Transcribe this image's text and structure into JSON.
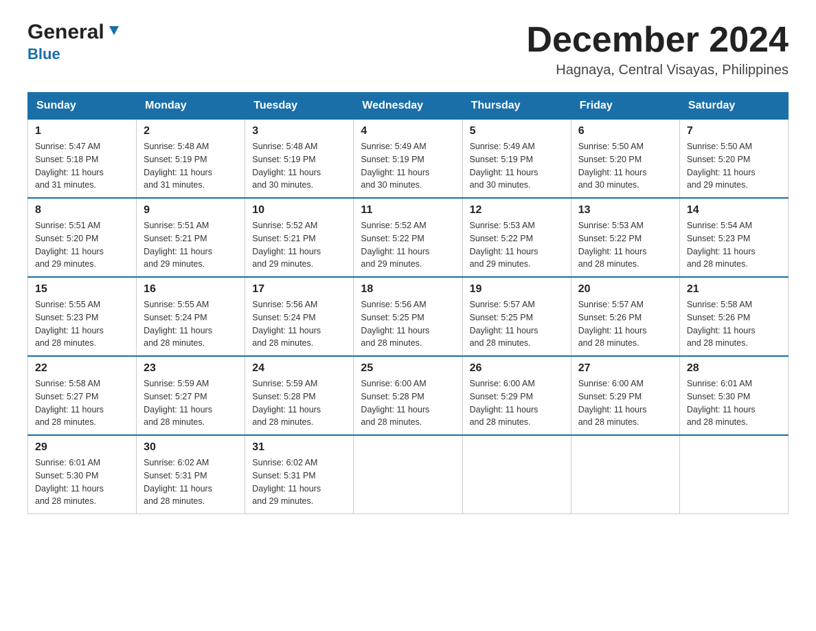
{
  "header": {
    "logo_general": "General",
    "logo_blue": "Blue",
    "month_title": "December 2024",
    "location": "Hagnaya, Central Visayas, Philippines"
  },
  "days_of_week": [
    "Sunday",
    "Monday",
    "Tuesday",
    "Wednesday",
    "Thursday",
    "Friday",
    "Saturday"
  ],
  "weeks": [
    [
      {
        "day": "1",
        "sunrise": "5:47 AM",
        "sunset": "5:18 PM",
        "daylight": "11 hours and 31 minutes."
      },
      {
        "day": "2",
        "sunrise": "5:48 AM",
        "sunset": "5:19 PM",
        "daylight": "11 hours and 31 minutes."
      },
      {
        "day": "3",
        "sunrise": "5:48 AM",
        "sunset": "5:19 PM",
        "daylight": "11 hours and 30 minutes."
      },
      {
        "day": "4",
        "sunrise": "5:49 AM",
        "sunset": "5:19 PM",
        "daylight": "11 hours and 30 minutes."
      },
      {
        "day": "5",
        "sunrise": "5:49 AM",
        "sunset": "5:19 PM",
        "daylight": "11 hours and 30 minutes."
      },
      {
        "day": "6",
        "sunrise": "5:50 AM",
        "sunset": "5:20 PM",
        "daylight": "11 hours and 30 minutes."
      },
      {
        "day": "7",
        "sunrise": "5:50 AM",
        "sunset": "5:20 PM",
        "daylight": "11 hours and 29 minutes."
      }
    ],
    [
      {
        "day": "8",
        "sunrise": "5:51 AM",
        "sunset": "5:20 PM",
        "daylight": "11 hours and 29 minutes."
      },
      {
        "day": "9",
        "sunrise": "5:51 AM",
        "sunset": "5:21 PM",
        "daylight": "11 hours and 29 minutes."
      },
      {
        "day": "10",
        "sunrise": "5:52 AM",
        "sunset": "5:21 PM",
        "daylight": "11 hours and 29 minutes."
      },
      {
        "day": "11",
        "sunrise": "5:52 AM",
        "sunset": "5:22 PM",
        "daylight": "11 hours and 29 minutes."
      },
      {
        "day": "12",
        "sunrise": "5:53 AM",
        "sunset": "5:22 PM",
        "daylight": "11 hours and 29 minutes."
      },
      {
        "day": "13",
        "sunrise": "5:53 AM",
        "sunset": "5:22 PM",
        "daylight": "11 hours and 28 minutes."
      },
      {
        "day": "14",
        "sunrise": "5:54 AM",
        "sunset": "5:23 PM",
        "daylight": "11 hours and 28 minutes."
      }
    ],
    [
      {
        "day": "15",
        "sunrise": "5:55 AM",
        "sunset": "5:23 PM",
        "daylight": "11 hours and 28 minutes."
      },
      {
        "day": "16",
        "sunrise": "5:55 AM",
        "sunset": "5:24 PM",
        "daylight": "11 hours and 28 minutes."
      },
      {
        "day": "17",
        "sunrise": "5:56 AM",
        "sunset": "5:24 PM",
        "daylight": "11 hours and 28 minutes."
      },
      {
        "day": "18",
        "sunrise": "5:56 AM",
        "sunset": "5:25 PM",
        "daylight": "11 hours and 28 minutes."
      },
      {
        "day": "19",
        "sunrise": "5:57 AM",
        "sunset": "5:25 PM",
        "daylight": "11 hours and 28 minutes."
      },
      {
        "day": "20",
        "sunrise": "5:57 AM",
        "sunset": "5:26 PM",
        "daylight": "11 hours and 28 minutes."
      },
      {
        "day": "21",
        "sunrise": "5:58 AM",
        "sunset": "5:26 PM",
        "daylight": "11 hours and 28 minutes."
      }
    ],
    [
      {
        "day": "22",
        "sunrise": "5:58 AM",
        "sunset": "5:27 PM",
        "daylight": "11 hours and 28 minutes."
      },
      {
        "day": "23",
        "sunrise": "5:59 AM",
        "sunset": "5:27 PM",
        "daylight": "11 hours and 28 minutes."
      },
      {
        "day": "24",
        "sunrise": "5:59 AM",
        "sunset": "5:28 PM",
        "daylight": "11 hours and 28 minutes."
      },
      {
        "day": "25",
        "sunrise": "6:00 AM",
        "sunset": "5:28 PM",
        "daylight": "11 hours and 28 minutes."
      },
      {
        "day": "26",
        "sunrise": "6:00 AM",
        "sunset": "5:29 PM",
        "daylight": "11 hours and 28 minutes."
      },
      {
        "day": "27",
        "sunrise": "6:00 AM",
        "sunset": "5:29 PM",
        "daylight": "11 hours and 28 minutes."
      },
      {
        "day": "28",
        "sunrise": "6:01 AM",
        "sunset": "5:30 PM",
        "daylight": "11 hours and 28 minutes."
      }
    ],
    [
      {
        "day": "29",
        "sunrise": "6:01 AM",
        "sunset": "5:30 PM",
        "daylight": "11 hours and 28 minutes."
      },
      {
        "day": "30",
        "sunrise": "6:02 AM",
        "sunset": "5:31 PM",
        "daylight": "11 hours and 28 minutes."
      },
      {
        "day": "31",
        "sunrise": "6:02 AM",
        "sunset": "5:31 PM",
        "daylight": "11 hours and 29 minutes."
      },
      null,
      null,
      null,
      null
    ]
  ],
  "labels": {
    "sunrise": "Sunrise:",
    "sunset": "Sunset:",
    "daylight": "Daylight:"
  }
}
